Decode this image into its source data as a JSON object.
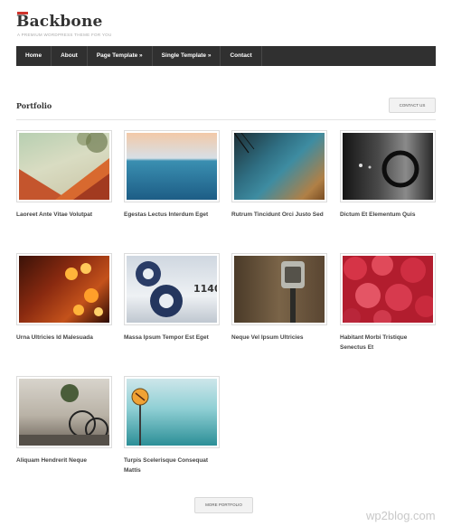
{
  "header": {
    "logo": "Backbone",
    "tagline": "A PREMIUM WORDPRESS THEME FOR YOU",
    "accent_color": "#d0342c"
  },
  "nav": {
    "items": [
      {
        "label": "Home"
      },
      {
        "label": "About"
      },
      {
        "label": "Page Template »"
      },
      {
        "label": "Single Template »"
      },
      {
        "label": "Contact"
      }
    ]
  },
  "portfolio": {
    "title": "Portfolio",
    "contact_button": "CONTACT US",
    "more_button": "MORE PORTFOLIO",
    "items": [
      {
        "caption": "Laoreet Ante Vitae Volutpat"
      },
      {
        "caption": "Egestas Lectus Interdum Eget"
      },
      {
        "caption": "Rutrum Tincidunt Orci Justo Sed"
      },
      {
        "caption": "Dictum Et Elementum Quis"
      },
      {
        "caption": "Urna Ultricies Id Malesuada"
      },
      {
        "caption": "Massa Ipsum Tempor Est Eget",
        "image_text": "1140"
      },
      {
        "caption": "Neque Vel Ipsum Ultricies"
      },
      {
        "caption": "Habitant Morbi Tristique Senectus Et"
      },
      {
        "caption": "Aliquam Hendrerit Neque"
      },
      {
        "caption": "Turpis Scelerisque Consequat Mattis"
      }
    ]
  },
  "watermark": "wp2blog.com"
}
